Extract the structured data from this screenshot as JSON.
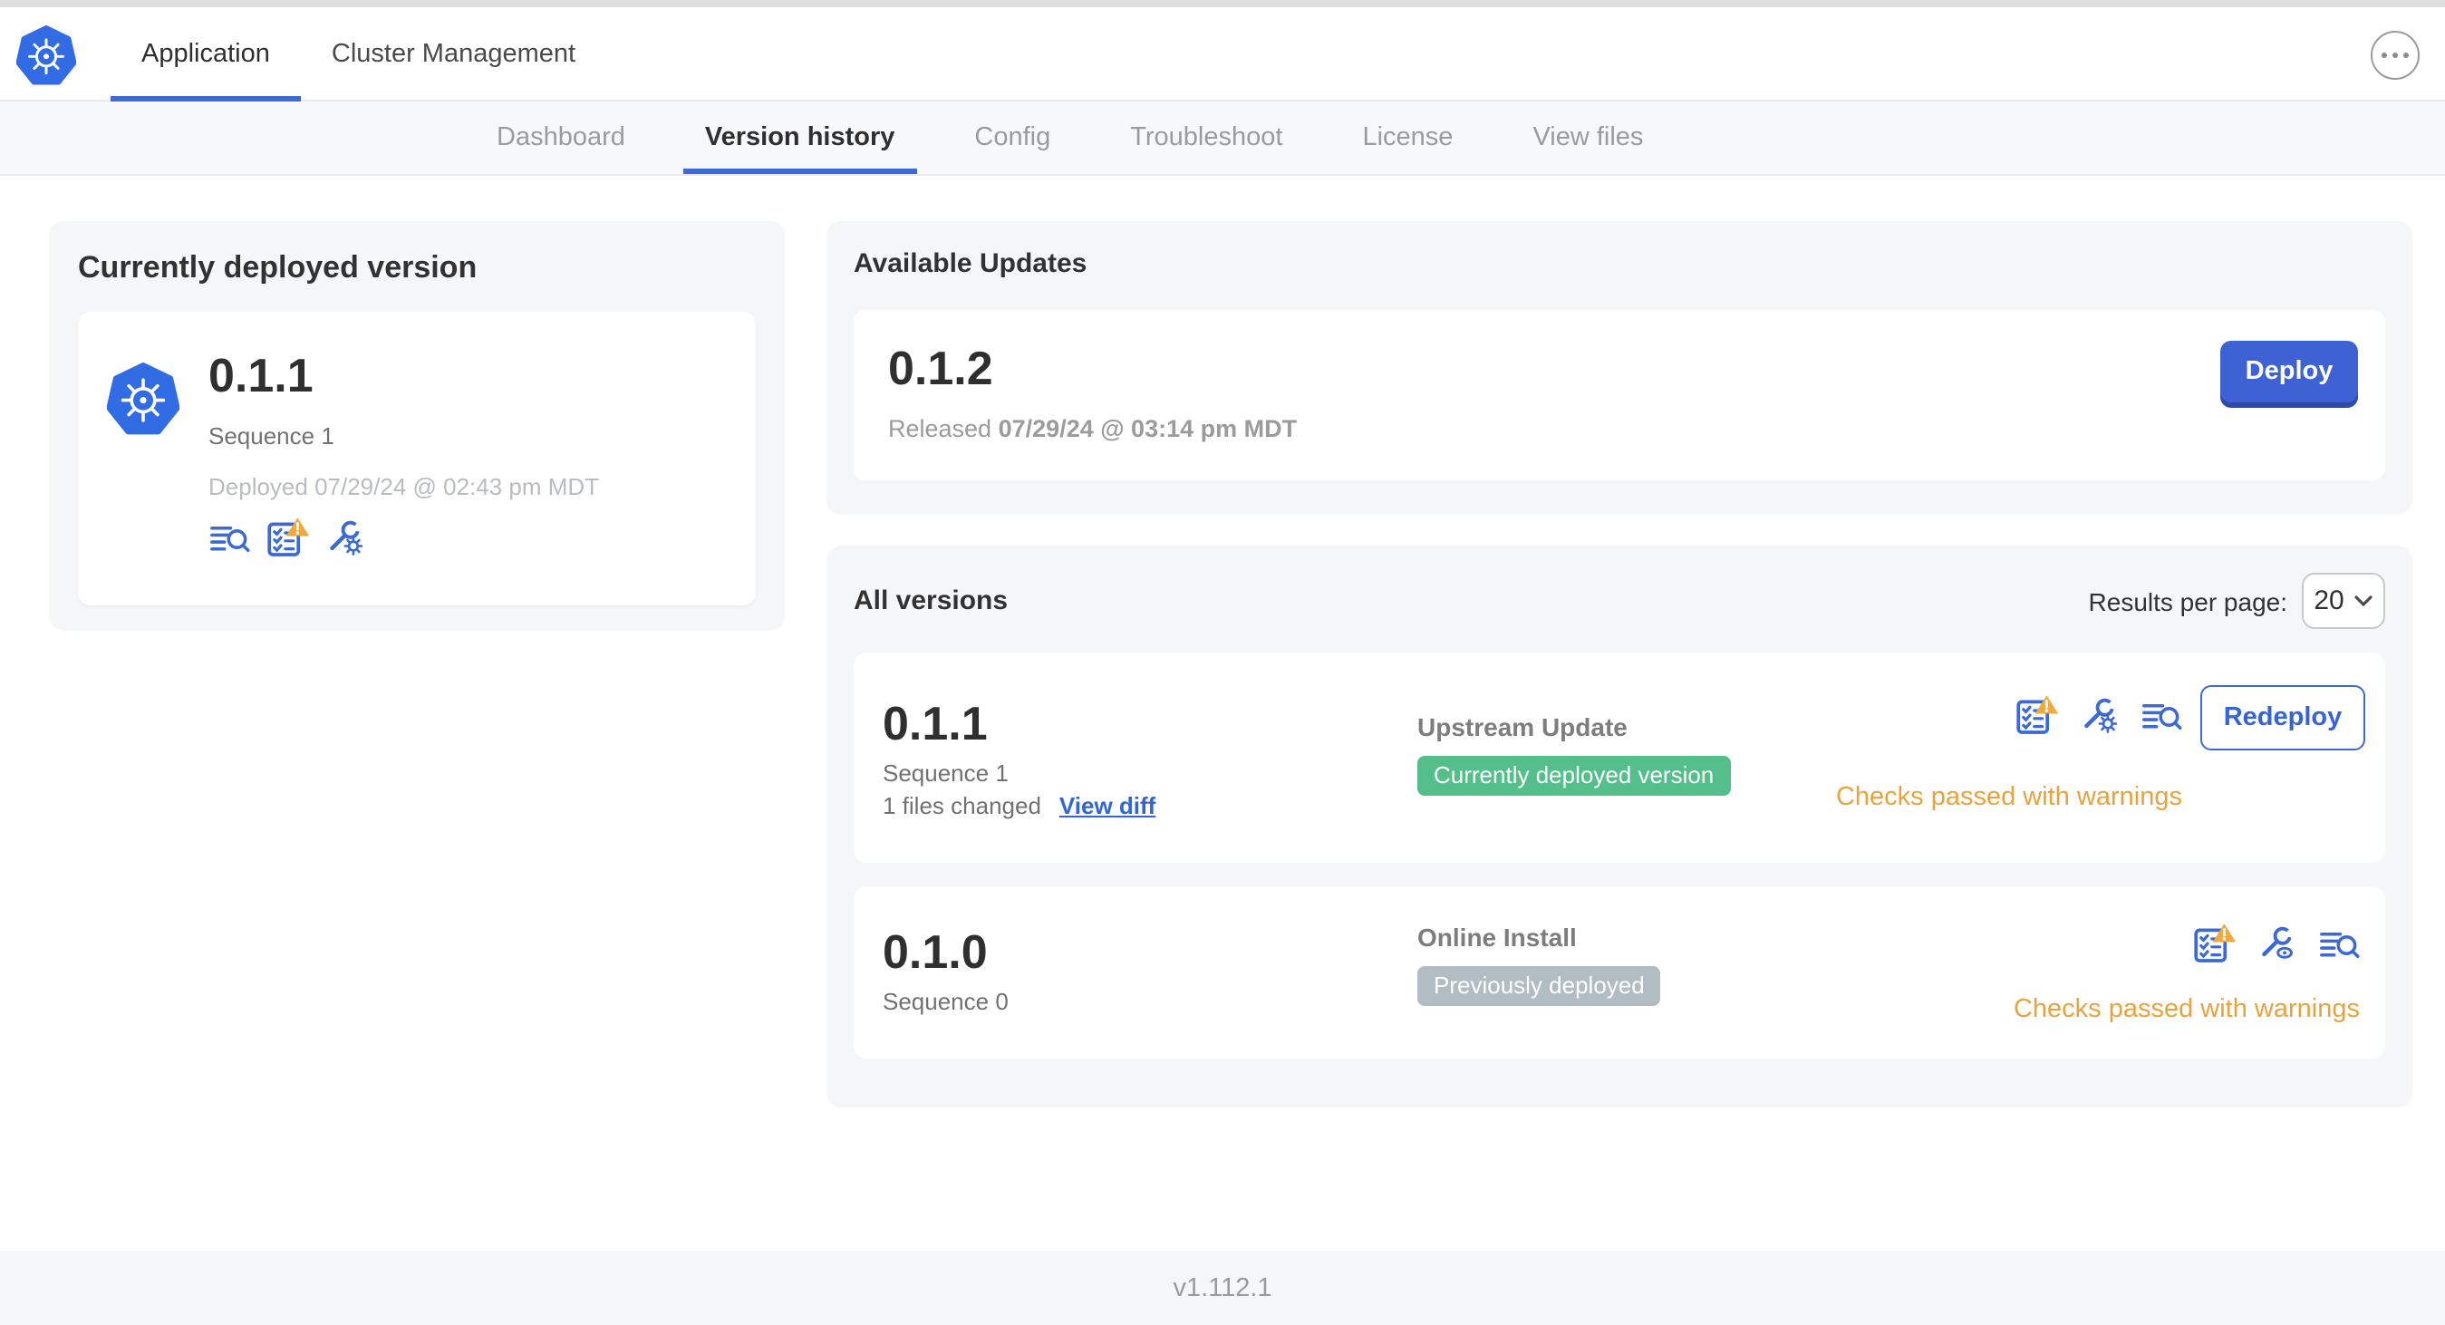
{
  "header": {
    "tabs": [
      {
        "label": "Application",
        "active": true
      },
      {
        "label": "Cluster Management",
        "active": false
      }
    ],
    "menu_icon": "ellipsis-menu-icon"
  },
  "subnav": {
    "tabs": [
      {
        "label": "Dashboard",
        "active": false
      },
      {
        "label": "Version history",
        "active": true
      },
      {
        "label": "Config",
        "active": false
      },
      {
        "label": "Troubleshoot",
        "active": false
      },
      {
        "label": "License",
        "active": false
      },
      {
        "label": "View files",
        "active": false
      }
    ]
  },
  "current_version": {
    "title": "Currently deployed version",
    "version": "0.1.1",
    "sequence": "Sequence 1",
    "deployed": "Deployed 07/29/24 @ 02:43 pm MDT",
    "icons": [
      "deploy-logs-icon",
      "preflight-checks-warning-icon",
      "config-gear-icon"
    ]
  },
  "available_updates": {
    "title": "Available Updates",
    "version": "0.1.2",
    "released_label": "Released",
    "released_date": "07/29/24 @ 03:14 pm MDT",
    "deploy_label": "Deploy"
  },
  "all_versions": {
    "title": "All versions",
    "results_per_page_label": "Results per page:",
    "results_per_page_value": "20",
    "rows": [
      {
        "version": "0.1.1",
        "sequence": "Sequence 1",
        "files_changed": "1 files changed",
        "view_diff_label": "View diff",
        "source": "Upstream Update",
        "badge": "Currently deployed version",
        "badge_color": "#55bf8c",
        "status": "Checks passed with warnings",
        "action_label": "Redeploy",
        "icons": [
          "preflight-checks-warning-icon",
          "config-gear-icon",
          "deploy-logs-icon"
        ]
      },
      {
        "version": "0.1.0",
        "sequence": "Sequence 0",
        "source": "Online Install",
        "badge": "Previously deployed",
        "badge_color": "#b2bcc3",
        "status": "Checks passed with warnings",
        "icons": [
          "preflight-checks-warning-icon",
          "view-config-eye-icon",
          "deploy-logs-icon"
        ]
      }
    ]
  },
  "footer": {
    "app_version": "v1.112.1"
  },
  "colors": {
    "accent_blue": "#3b6ad6",
    "brand_blue": "#326CE5",
    "deploy_button": "#3e61d4",
    "badge_green": "#55bf8c",
    "badge_gray": "#b2bcc3",
    "warning_orange": "#e8a33d",
    "panel_gray": "#f5f6f8"
  }
}
